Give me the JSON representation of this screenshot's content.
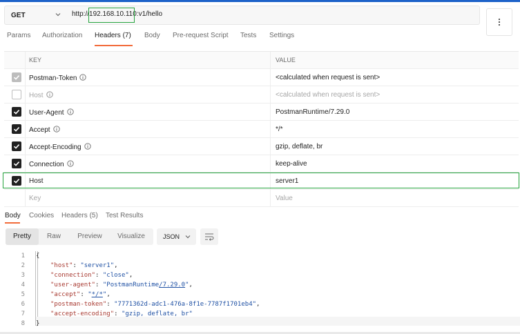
{
  "request": {
    "method": "GET",
    "url_prefix": "http://",
    "url_host": "192.168.10.110",
    "url_path": ":v1/hello"
  },
  "request_tabs": [
    {
      "label": "Params"
    },
    {
      "label": "Authorization"
    },
    {
      "label": "Headers (7)"
    },
    {
      "label": "Body"
    },
    {
      "label": "Pre-request Script"
    },
    {
      "label": "Tests"
    },
    {
      "label": "Settings"
    }
  ],
  "headers_table": {
    "col_key": "KEY",
    "col_value": "VALUE",
    "rows": [
      {
        "key": "Postman-Token",
        "value": "<calculated when request is sent>",
        "state": "disabled-checked",
        "info": true
      },
      {
        "key": "Host",
        "value": "<calculated when request is sent>",
        "state": "unchecked",
        "info": true
      },
      {
        "key": "User-Agent",
        "value": "PostmanRuntime/7.29.0",
        "state": "checked",
        "info": true
      },
      {
        "key": "Accept",
        "value": "*/*",
        "state": "checked",
        "info": true
      },
      {
        "key": "Accept-Encoding",
        "value": "gzip, deflate, br",
        "state": "checked",
        "info": true
      },
      {
        "key": "Connection",
        "value": "keep-alive",
        "state": "checked",
        "info": true
      },
      {
        "key": "Host",
        "value": "server1",
        "state": "checked",
        "info": false
      }
    ],
    "new_key_placeholder": "Key",
    "new_value_placeholder": "Value"
  },
  "response_tabs": [
    {
      "label": "Body"
    },
    {
      "label": "Cookies"
    },
    {
      "label": "Headers (5)"
    },
    {
      "label": "Test Results"
    }
  ],
  "view_buttons": [
    {
      "label": "Pretty"
    },
    {
      "label": "Raw"
    },
    {
      "label": "Preview"
    },
    {
      "label": "Visualize"
    }
  ],
  "format": "JSON",
  "code_lines": [
    {
      "n": "1"
    },
    {
      "n": "2",
      "key": "\"host\"",
      "val": "\"server1\""
    },
    {
      "n": "3",
      "key": "\"connection\"",
      "val": "\"close\""
    },
    {
      "n": "4",
      "key": "\"user-agent\"",
      "val_pre": "\"PostmanRuntime",
      "val_link": "/7.29.0",
      "val_post": "\""
    },
    {
      "n": "5",
      "key": "\"accept\"",
      "val_pre": "\"",
      "val_link": "*/*",
      "val_post": "\""
    },
    {
      "n": "6",
      "key": "\"postman-token\"",
      "val": "\"7771362d-adc1-476a-8f1e-7787f1701eb4\""
    },
    {
      "n": "7",
      "key": "\"accept-encoding\"",
      "val": "\"gzip, deflate, br\""
    },
    {
      "n": "8"
    }
  ],
  "colors": {
    "accent_tab": "#f26b3a",
    "highlight_box": "#25a33d",
    "json_key": "#a7382f",
    "json_string": "#1d4fa3"
  }
}
